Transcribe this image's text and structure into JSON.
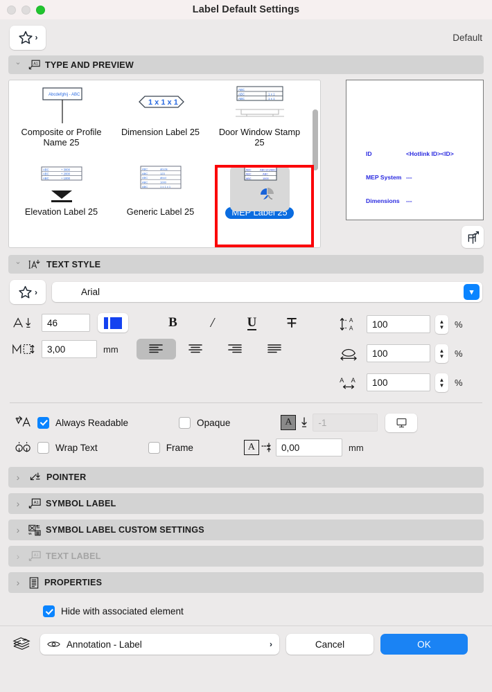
{
  "window": {
    "title": "Label Default Settings",
    "traffic_lights": [
      "close-inactive",
      "minimize-inactive",
      "zoom-green"
    ]
  },
  "favorites": {
    "icon": "star-icon",
    "chevron": "›",
    "right_label": "Default"
  },
  "sections": {
    "type_and_preview": {
      "title": "TYPE AND PREVIEW",
      "icon": "label-a1-icon",
      "expanded": true
    },
    "text_style": {
      "title": "TEXT STYLE",
      "icon": "text-style-icon",
      "expanded": true
    },
    "collapsed": [
      {
        "title": "POINTER",
        "icon": "pointer-icon",
        "disabled": false
      },
      {
        "title": "SYMBOL LABEL",
        "icon": "symbol-label-icon",
        "disabled": false
      },
      {
        "title": "SYMBOL LABEL CUSTOM SETTINGS",
        "icon": "symbol-custom-icon",
        "disabled": false
      },
      {
        "title": "TEXT LABEL",
        "icon": "text-label-icon",
        "disabled": true
      },
      {
        "title": "PROPERTIES",
        "icon": "properties-icon",
        "disabled": false
      }
    ]
  },
  "gallery": {
    "items": [
      {
        "name": "Composite or Profile Name 25",
        "thumb": "composite-profile-thumb",
        "selected": false
      },
      {
        "name": "Dimension Label 25",
        "thumb": "dimension-label-thumb",
        "selected": false
      },
      {
        "name": "Door Window Stamp 25",
        "thumb": "door-window-stamp-thumb",
        "selected": false
      },
      {
        "name": "Elevation Label 25",
        "thumb": "elevation-label-thumb",
        "selected": false
      },
      {
        "name": "Generic Label 25",
        "thumb": "generic-label-thumb",
        "selected": false
      },
      {
        "name": "MEP Label 25",
        "thumb": "mep-label-thumb",
        "selected": true
      }
    ],
    "thumb_text": {
      "composite": "Abcdefghij - ABC",
      "dimension": "1 x 1 x 1",
      "door_window": [
        "ABC",
        "ABC",
        "ABC",
        "1 x 1",
        "1 x 1"
      ],
      "elevation": [
        [
          "ABC",
          "+ 3000"
        ],
        [
          "ABC",
          "+ 2000"
        ],
        [
          "ABC",
          "+ 1000"
        ]
      ],
      "generic": [
        [
          "ABC",
          "abcde"
        ],
        [
          "ABC",
          "123"
        ],
        [
          "ABC",
          "abcd"
        ],
        [
          "ABC",
          "1000"
        ],
        [
          "ABC",
          "1 x 1 x 1"
        ]
      ],
      "mep": [
        [
          "ABC",
          "ABC121ABC1"
        ],
        [
          "ABC",
          "ABC"
        ],
        [
          "ABC",
          "1000"
        ]
      ]
    },
    "scrollbar": "vertical-scrollbar"
  },
  "preview": {
    "rows": [
      {
        "key": "ID",
        "value": "<Hotlink ID><ID>"
      },
      {
        "key": "MEP System",
        "value": "---"
      },
      {
        "key": "Dimensions",
        "value": "---"
      }
    ],
    "color": "#2a2ae0",
    "button_3d": "3d-view-icon"
  },
  "text_style": {
    "font": {
      "value": "Arial",
      "favorites_icon": "star-icon",
      "dropdown_icon": "chevron-down-icon"
    },
    "pen": {
      "icon": "pen-color-icon",
      "value": "46",
      "swatch_color": "#1442f0"
    },
    "size": {
      "icon": "text-size-icon",
      "value": "3,00",
      "unit": "mm"
    },
    "style_buttons": [
      {
        "name": "bold",
        "glyph": "B",
        "active": false
      },
      {
        "name": "italic",
        "glyph": "I",
        "active": false
      },
      {
        "name": "underline",
        "glyph": "U",
        "active": false
      },
      {
        "name": "strikethrough",
        "glyph": "T",
        "active": false
      }
    ],
    "align_buttons": [
      {
        "name": "align-left",
        "active": true
      },
      {
        "name": "align-center",
        "active": false
      },
      {
        "name": "align-right",
        "active": false
      },
      {
        "name": "align-justify",
        "active": false
      }
    ],
    "spinners": [
      {
        "name": "line-spacing",
        "icon": "line-spacing-icon",
        "value": "100",
        "unit": "%"
      },
      {
        "name": "character-width",
        "icon": "char-width-icon",
        "value": "100",
        "unit": "%"
      },
      {
        "name": "character-spacing",
        "icon": "char-spacing-icon",
        "value": "100",
        "unit": "%"
      }
    ],
    "options": {
      "always_readable": {
        "label": "Always Readable",
        "checked": true,
        "icon": "always-readable-icon"
      },
      "wrap_text": {
        "label": "Wrap Text",
        "checked": false,
        "icon": "wrap-text-icon"
      },
      "opaque": {
        "label": "Opaque",
        "checked": false
      },
      "frame": {
        "label": "Frame",
        "checked": false
      },
      "background_pen": {
        "icon": "background-pen-icon",
        "value": "-1",
        "disabled": true,
        "button_icon": "screen-icon"
      },
      "frame_offset": {
        "icon": "frame-offset-icon",
        "value": "0,00",
        "unit": "mm"
      }
    }
  },
  "footer": {
    "hide_with_element": {
      "label": "Hide with associated element",
      "checked": true
    },
    "layer": {
      "icon": "layers-icon",
      "eye_icon": "eye-icon",
      "name": "Annotation - Label",
      "chevron": "›"
    },
    "cancel_label": "Cancel",
    "ok_label": "OK"
  }
}
